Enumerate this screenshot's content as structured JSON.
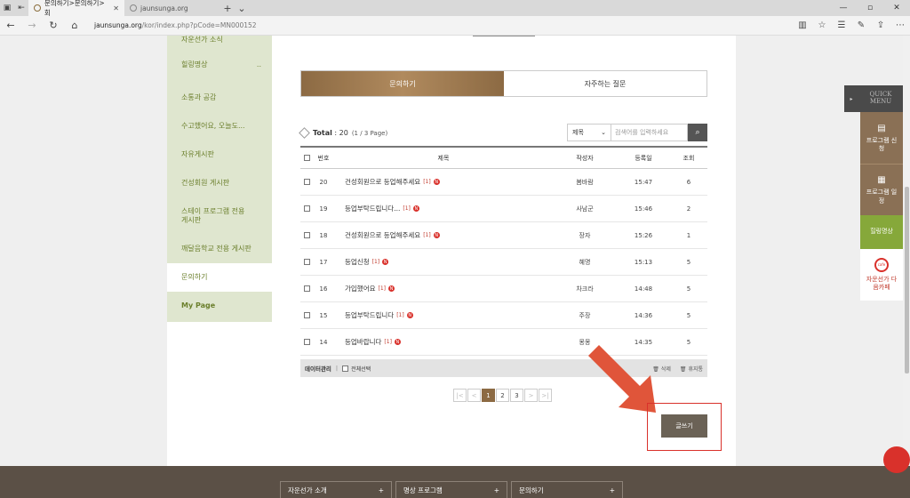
{
  "browser": {
    "tabs": [
      {
        "title": "문의하기>문의하기>회",
        "active": true
      },
      {
        "title": "jaunsunga.org",
        "active": false
      }
    ],
    "url_host": "jaunsunga.org",
    "url_path": "/kor/index.php?pCode=MN000152"
  },
  "sidebar": {
    "items": [
      {
        "label": "자운선가 소식"
      },
      {
        "label": "힐링명상",
        "extra": ".."
      },
      {
        "label": "소통과 공감"
      },
      {
        "label": "수고했어요, 오늘도..."
      },
      {
        "label": "자유게시판"
      },
      {
        "label": "건성회원 게시판"
      },
      {
        "label": "스테이 프로그램 전용 게시판"
      },
      {
        "label": "깨달음학교 전용 게시판"
      },
      {
        "label": "문의하기"
      },
      {
        "label": "My Page"
      }
    ]
  },
  "board": {
    "tabs": [
      "문의하기",
      "자주하는 질문"
    ],
    "total_label": "Total",
    "total_count": ": 20",
    "page_info": "(1 / 3 Page)",
    "search_select": "제목",
    "search_placeholder": "검색어를 입력하세요",
    "columns": [
      "번호",
      "제목",
      "작성자",
      "등록일",
      "조회"
    ],
    "rows": [
      {
        "no": "20",
        "title": "건성회원으로 등업해주세요",
        "comments": "[1]",
        "writer": "봄바람",
        "date": "15:47",
        "views": "6"
      },
      {
        "no": "19",
        "title": "등업부탁드립니다...",
        "comments": "[1]",
        "writer": "사남군",
        "date": "15:46",
        "views": "2"
      },
      {
        "no": "18",
        "title": "건성회원으로 등업해주세요",
        "comments": "[1]",
        "writer": "장자",
        "date": "15:26",
        "views": "1"
      },
      {
        "no": "17",
        "title": "등업신청",
        "comments": "[1]",
        "writer": "혜명",
        "date": "15:13",
        "views": "5"
      },
      {
        "no": "16",
        "title": "가입했어요",
        "comments": "[1]",
        "writer": "차크라",
        "date": "14:48",
        "views": "5"
      },
      {
        "no": "15",
        "title": "등업부탁드립니다",
        "comments": "[1]",
        "writer": "주장",
        "date": "14:36",
        "views": "5"
      },
      {
        "no": "14",
        "title": "등업바랍니다",
        "comments": "[1]",
        "writer": "몽몽",
        "date": "14:35",
        "views": "5"
      }
    ],
    "new_badge": "N",
    "admin": {
      "label": "데이터관리",
      "select_all": "전체선택",
      "delete": "삭제",
      "restore": "삭제",
      "trash": "휴지통"
    },
    "pagination": {
      "first": "|<",
      "prev": "<",
      "pages": [
        "1",
        "2",
        "3"
      ],
      "current": "1",
      "next": ">",
      "last": ">|"
    },
    "write_label": "글쓰기"
  },
  "quick_menu": {
    "header": "QUICK MENU",
    "items": [
      {
        "label": "프로그램 신청",
        "icon": "document-icon"
      },
      {
        "label": "프로그램 일정",
        "icon": "calendar-icon"
      },
      {
        "label": "힐링명상",
        "icon": ""
      },
      {
        "label": "자운선가 다음카페",
        "icon": "cafe-icon",
        "icon_text": "cafe"
      }
    ]
  },
  "footer": {
    "boxes": [
      {
        "label": "자운선가 소개"
      },
      {
        "label": "명상 프로그램"
      },
      {
        "label": "문의하기"
      }
    ],
    "plus": "+"
  },
  "colors": {
    "brand_brown": "#8c6a43",
    "sidebar_green": "#dfe6cf",
    "accent_red": "#d9312b",
    "footer": "#5b5046"
  }
}
